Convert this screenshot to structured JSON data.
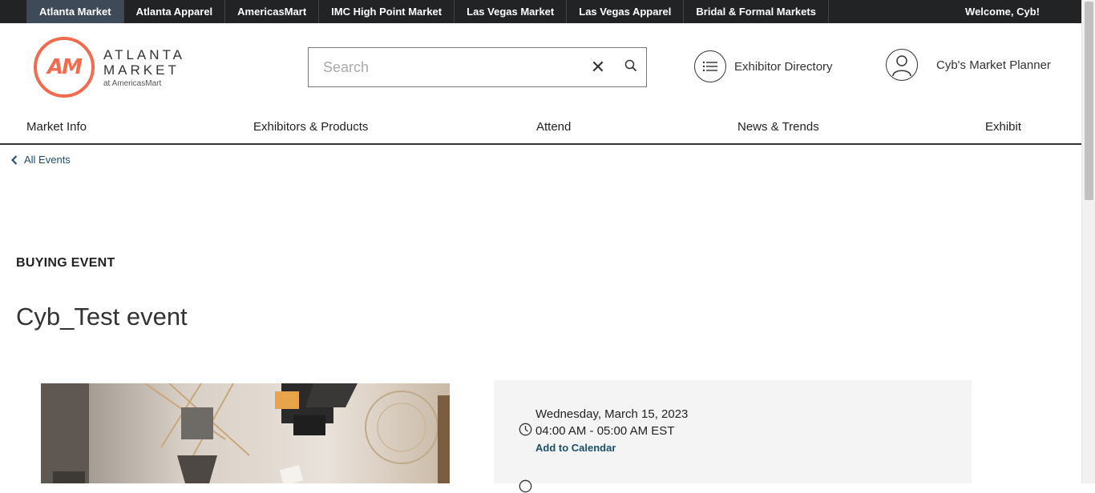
{
  "topbar": {
    "tabs": [
      "Atlanta Market",
      "Atlanta Apparel",
      "AmericasMart",
      "IMC High Point Market",
      "Las Vegas Market",
      "Las Vegas Apparel",
      "Bridal & Formal Markets"
    ],
    "welcome": "Welcome, Cyb!"
  },
  "logo": {
    "mark": "AM",
    "line1": "ATLANTA",
    "line2": "MARKET",
    "line3": "at AmericasMart",
    "color": "#f26b4f"
  },
  "search": {
    "placeholder": "Search"
  },
  "utility": {
    "directory_label": "Exhibitor Directory",
    "planner_label": "Cyb's Market Planner"
  },
  "nav": {
    "items": [
      "Market Info",
      "Exhibitors & Products",
      "Attend",
      "News & Trends",
      "Exhibit"
    ]
  },
  "back_link": "All Events",
  "event": {
    "eyebrow": "BUYING EVENT",
    "title": "Cyb_Test event",
    "date": "Wednesday, March 15, 2023",
    "time": "04:00 AM - 05:00 AM EST",
    "calendar_link": "Add to Calendar"
  },
  "colors": {
    "topbar_bg": "#222324",
    "active_tab": "#3e4a57",
    "link": "#1d4f66",
    "panel_bg": "#f4f4f4"
  }
}
